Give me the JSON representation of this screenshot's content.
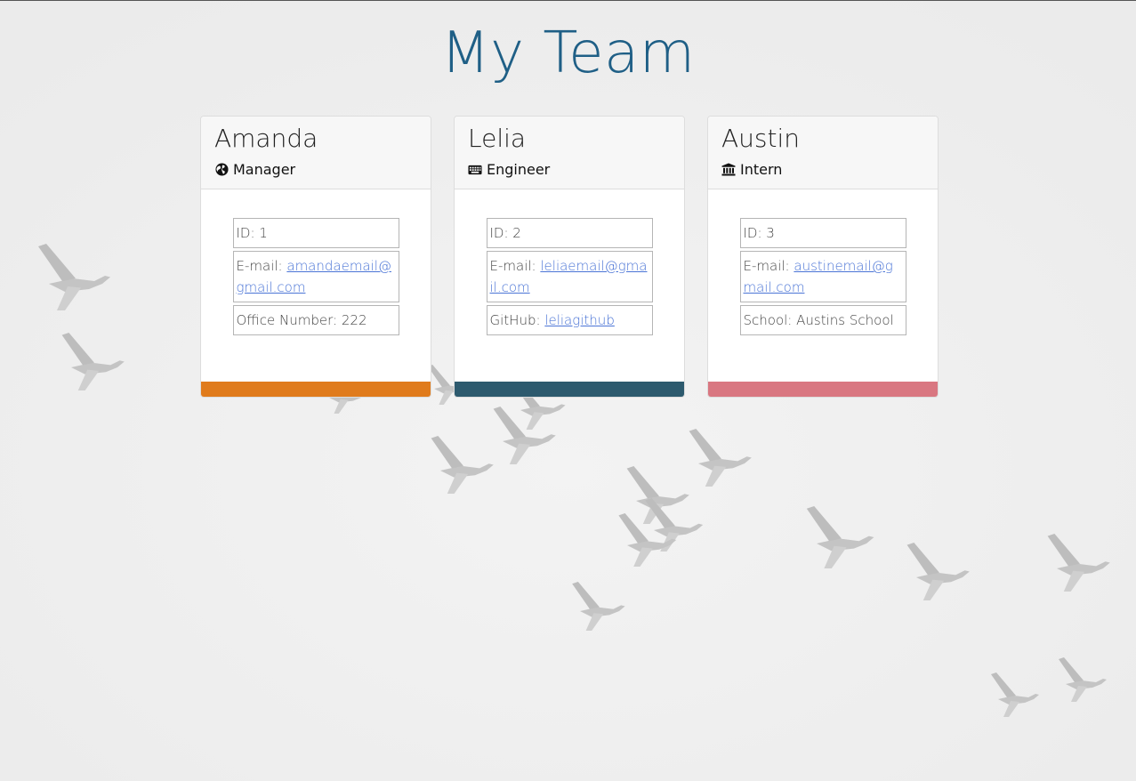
{
  "page": {
    "title": "My Team"
  },
  "colors": {
    "title": "#1f5f86",
    "manager_footer": "#e07b1c",
    "engineer_footer": "#2d5a6e",
    "intern_footer": "#d97781",
    "link": "#4a74d6"
  },
  "team": [
    {
      "name": "Amanda",
      "role": "Manager",
      "icon": "globe-icon",
      "id_text": "ID: 1",
      "email_label": "E-mail:",
      "email": "amandaemail@gmail.com",
      "extra_label": "Office Number:",
      "extra_value": "222"
    },
    {
      "name": "Lelia",
      "role": "Engineer",
      "icon": "keyboard-icon",
      "id_text": "ID: 2",
      "email_label": "E-mail:",
      "email": "leliaemail@gmail.com",
      "extra_label": "GitHub:",
      "extra_value": "leliagithub"
    },
    {
      "name": "Austin",
      "role": "Intern",
      "icon": "university-icon",
      "id_text": "ID: 3",
      "email_label": "E-mail:",
      "email": "austinemail@gmail.com",
      "extra_label": "School:",
      "extra_value": "Austins School"
    }
  ]
}
